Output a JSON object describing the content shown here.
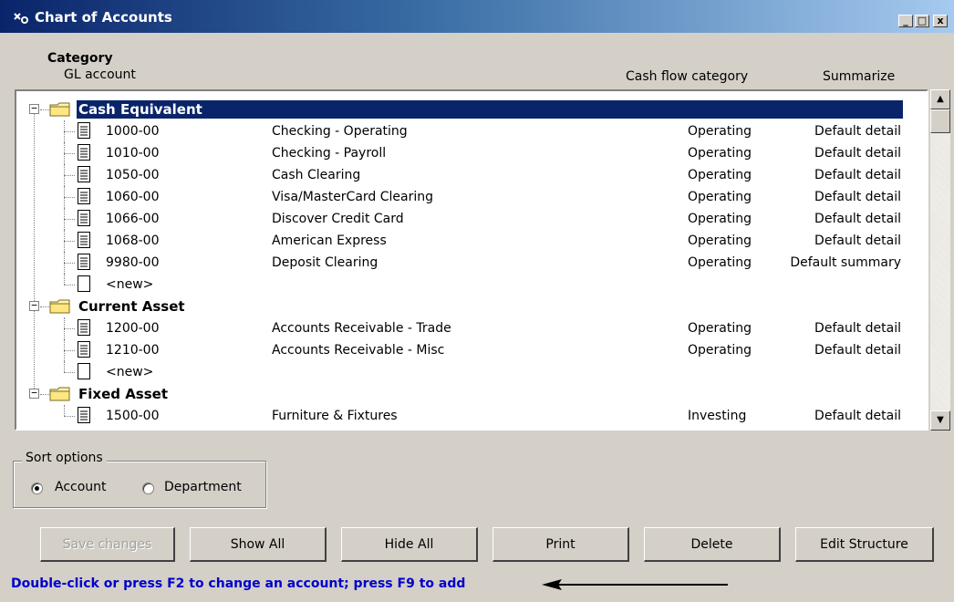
{
  "window": {
    "title": "Chart of Accounts",
    "buttons": {
      "minimize": "_",
      "maximize": "□",
      "close": "x"
    }
  },
  "columns": {
    "category": "Category",
    "gl_account": "GL account",
    "cash_flow": "Cash flow category",
    "summarize": "Summarize"
  },
  "tree": {
    "categories": [
      {
        "name": "Cash Equivalent",
        "selected": true,
        "accounts": [
          {
            "gl": "1000-00",
            "name": "Checking - Operating",
            "cash": "Operating",
            "sum": "Default detail"
          },
          {
            "gl": "1010-00",
            "name": "Checking - Payroll",
            "cash": "Operating",
            "sum": "Default detail"
          },
          {
            "gl": "1050-00",
            "name": "Cash Clearing",
            "cash": "Operating",
            "sum": "Default detail"
          },
          {
            "gl": "1060-00",
            "name": "Visa/MasterCard Clearing",
            "cash": "Operating",
            "sum": "Default detail"
          },
          {
            "gl": "1066-00",
            "name": "Discover Credit Card",
            "cash": "Operating",
            "sum": "Default detail"
          },
          {
            "gl": "1068-00",
            "name": "American Express",
            "cash": "Operating",
            "sum": "Default detail"
          },
          {
            "gl": "9980-00",
            "name": "Deposit Clearing",
            "cash": "Operating",
            "sum": "Default summary"
          },
          {
            "gl": "<new>",
            "name": "",
            "cash": "",
            "sum": "",
            "is_new": true
          }
        ]
      },
      {
        "name": "Current Asset",
        "selected": false,
        "accounts": [
          {
            "gl": "1200-00",
            "name": "Accounts Receivable - Trade",
            "cash": "Operating",
            "sum": "Default detail"
          },
          {
            "gl": "1210-00",
            "name": "Accounts Receivable - Misc",
            "cash": "Operating",
            "sum": "Default detail"
          },
          {
            "gl": "<new>",
            "name": "",
            "cash": "",
            "sum": "",
            "is_new": true
          }
        ]
      },
      {
        "name": "Fixed Asset",
        "selected": false,
        "accounts": [
          {
            "gl": "1500-00",
            "name": "Furniture & Fixtures",
            "cash": "Investing",
            "sum": "Default detail"
          }
        ]
      }
    ]
  },
  "sort_options": {
    "legend": "Sort options",
    "account": "Account",
    "department": "Department",
    "selected": "account"
  },
  "buttons": {
    "save": "Save changes",
    "show_all": "Show All",
    "hide_all": "Hide All",
    "print": "Print",
    "delete": "Delete",
    "edit_structure": "Edit Structure"
  },
  "status": {
    "hint": "Double-click or press F2 to change an account; press F9 to add"
  },
  "colors": {
    "title_start": "#0a246a",
    "title_end": "#a6caf0",
    "selection": "#0a246a",
    "status_text": "#0000cc",
    "window_bg": "#d4d0c8"
  }
}
